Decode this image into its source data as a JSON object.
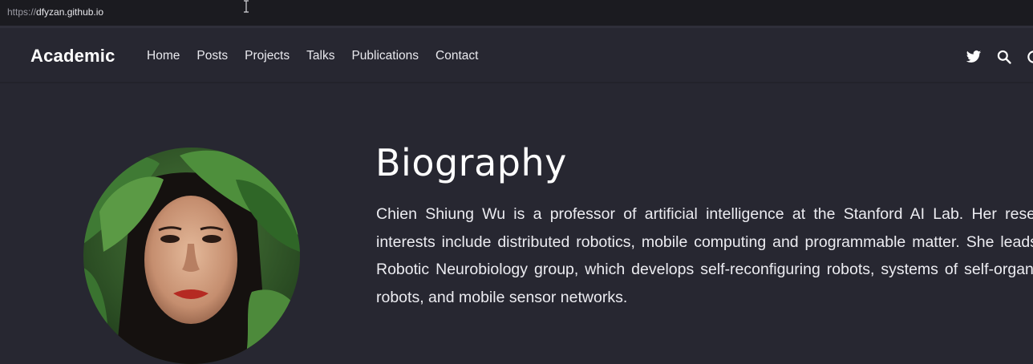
{
  "browser": {
    "url_scheme": "https://",
    "url_host": "dfyzan.github.io"
  },
  "navbar": {
    "brand": "Academic",
    "links": [
      "Home",
      "Posts",
      "Projects",
      "Talks",
      "Publications",
      "Contact"
    ],
    "icons": [
      "twitter-icon",
      "search-icon",
      "theme-toggle-icon"
    ]
  },
  "about": {
    "heading": "Biography",
    "bio": "Chien Shiung Wu is a professor of artificial intelligence at the Stanford AI Lab. Her research interests include distributed robotics, mobile computing and programmable matter. She leads the Robotic Neurobiology group, which develops self-reconfiguring robots, systems of self-organizing robots, and mobile sensor networks."
  },
  "colors": {
    "background": "#272731",
    "browser_bar": "#1b1b20",
    "text": "#ffffff"
  }
}
